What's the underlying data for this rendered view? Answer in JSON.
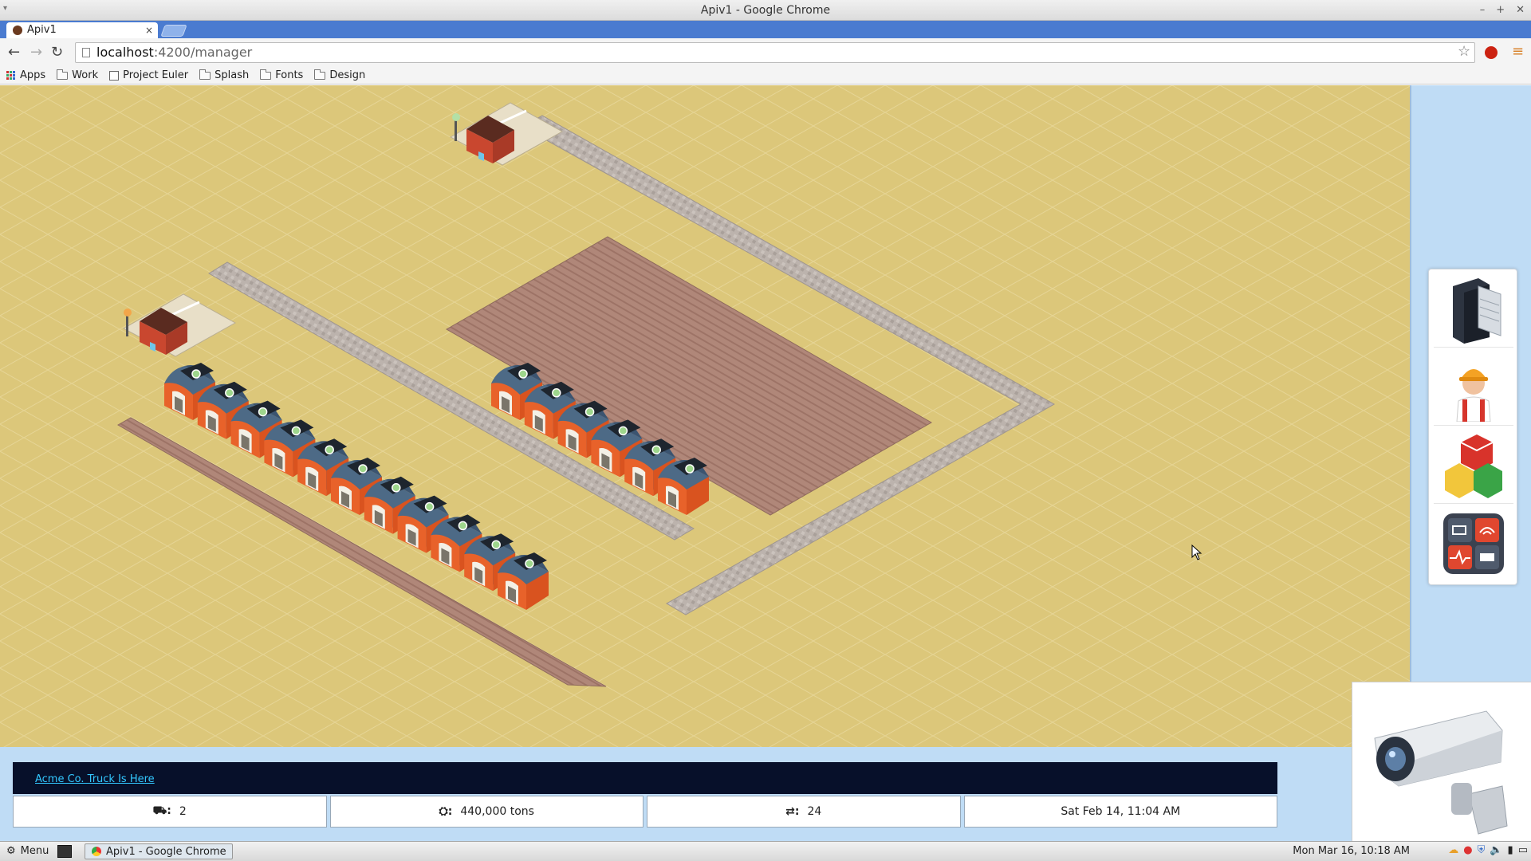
{
  "window": {
    "title": "Apiv1 - Google Chrome",
    "menu_glyph": "▾",
    "controls": [
      "–",
      "+",
      "✕"
    ]
  },
  "tab": {
    "label": "Apiv1",
    "close": "×"
  },
  "toolbar": {
    "back": "←",
    "forward": "→",
    "reload": "↻",
    "url_host": "localhost",
    "url_path": ":4200/manager",
    "star": "☆",
    "menu": "≡"
  },
  "bookmarks": [
    {
      "label": "Apps",
      "icon": "apps-grid-icon"
    },
    {
      "label": "Work",
      "icon": "folder-icon"
    },
    {
      "label": "Project Euler",
      "icon": "project-euler-icon"
    },
    {
      "label": "Splash",
      "icon": "folder-icon"
    },
    {
      "label": "Fonts",
      "icon": "folder-icon"
    },
    {
      "label": "Design",
      "icon": "folder-icon"
    }
  ],
  "tools": [
    {
      "name": "server-rack-icon"
    },
    {
      "name": "worker-icon"
    },
    {
      "name": "cargo-boxes-icon"
    },
    {
      "name": "system-status-icon"
    }
  ],
  "camera": {
    "icon": "security-camera-icon"
  },
  "news": {
    "link": "Acme Co. Truck Is Here"
  },
  "stats": [
    {
      "icon": "truck-icon",
      "icon_glyph": "⛟:",
      "value": "2"
    },
    {
      "icon": "cargo-icon",
      "icon_glyph": "⛭:",
      "value": "440,000 tons"
    },
    {
      "icon": "transfer-icon",
      "icon_glyph": "⇄:",
      "value": "24"
    },
    {
      "icon": "calendar-icon",
      "icon_glyph": "",
      "value": "Sat Feb 14, 11:04 AM"
    }
  ],
  "taskbar": {
    "menu": "Menu",
    "app": "Apiv1 - Google Chrome",
    "clock": "Mon Mar 16, 10:18 AM"
  },
  "colors": {
    "ground": "#dcc77a",
    "road": "#b8aea8",
    "field": "#b28a7c",
    "barn_front": "#e8622a",
    "barn_roof": "#4d6a86",
    "panel_bg": "#bfdcf5",
    "news_bg": "#07102a",
    "news_link": "#33c8ff"
  },
  "scene": {
    "warehouses_row_a": 11,
    "warehouses_row_b": 6,
    "depots": 2
  }
}
